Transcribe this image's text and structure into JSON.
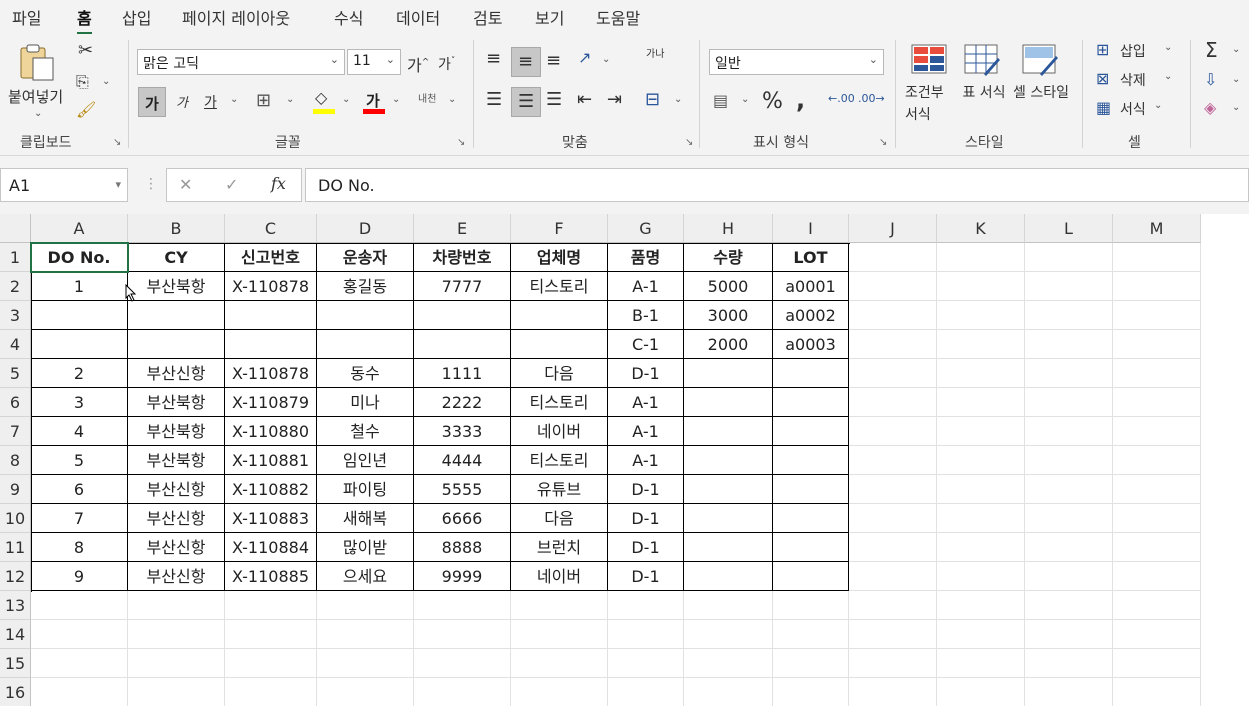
{
  "menu": {
    "tabs": [
      "파일",
      "홈",
      "삽입",
      "페이지 레이아웃",
      "수식",
      "데이터",
      "검토",
      "보기",
      "도움말"
    ],
    "active": "홈"
  },
  "ribbon": {
    "clipboard": {
      "paste": "붙여넣기",
      "label": "클립보드"
    },
    "font": {
      "name": "맑은 고딕",
      "size": "11",
      "bold": "가",
      "italic": "가",
      "underline": "가",
      "font_color": "가",
      "grow": "가",
      "shrink": "가",
      "phonetic": "내천",
      "label": "글꼴"
    },
    "alignment": {
      "wrap": "가나",
      "label": "맞춤"
    },
    "number": {
      "format": "일반",
      "percent": "%",
      "comma": ",",
      "inc_decimal": ".00",
      "dec_decimal": ".00",
      "label": "표시 형식"
    },
    "styles": {
      "conditional": "조건부 서식",
      "table": "표 서식",
      "cell": "셀 스타일",
      "label": "스타일"
    },
    "cells": {
      "insert": "삽입",
      "delete": "삭제",
      "format": "서식",
      "label": "셀"
    },
    "editing": {
      "autosum": "Σ"
    },
    "accent_color": "#217346",
    "font_color_bar": "#ff0000",
    "fill_color_bar": "#ffff00"
  },
  "formula_bar": {
    "name_box": "A1",
    "cancel": "✕",
    "enter": "✓",
    "fx": "fx",
    "content": "DO No."
  },
  "sheet": {
    "columns": [
      "A",
      "B",
      "C",
      "D",
      "E",
      "F",
      "G",
      "H",
      "I",
      "J",
      "K",
      "L",
      "M"
    ],
    "rows": [
      "1",
      "2",
      "3",
      "4",
      "5",
      "6",
      "7",
      "8",
      "9",
      "10",
      "11",
      "12",
      "13",
      "14",
      "15",
      "16"
    ],
    "header": [
      "DO No.",
      "CY",
      "신고번호",
      "운송자",
      "차량번호",
      "업체명",
      "품명",
      "수량",
      "LOT"
    ],
    "data": [
      [
        "1",
        "부산북항",
        "X-110878",
        "홍길동",
        "7777",
        "티스토리",
        "A-1",
        "5000",
        "a0001"
      ],
      [
        "",
        "",
        "",
        "",
        "",
        "",
        "B-1",
        "3000",
        "a0002"
      ],
      [
        "",
        "",
        "",
        "",
        "",
        "",
        "C-1",
        "2000",
        "a0003"
      ],
      [
        "2",
        "부산신항",
        "X-110878",
        "동수",
        "1111",
        "다음",
        "D-1",
        "",
        ""
      ],
      [
        "3",
        "부산북항",
        "X-110879",
        "미나",
        "2222",
        "티스토리",
        "A-1",
        "",
        ""
      ],
      [
        "4",
        "부산북항",
        "X-110880",
        "철수",
        "3333",
        "네이버",
        "A-1",
        "",
        ""
      ],
      [
        "5",
        "부산북항",
        "X-110881",
        "임인년",
        "4444",
        "티스토리",
        "A-1",
        "",
        ""
      ],
      [
        "6",
        "부산신항",
        "X-110882",
        "파이팅",
        "5555",
        "유튜브",
        "D-1",
        "",
        ""
      ],
      [
        "7",
        "부산신항",
        "X-110883",
        "새해복",
        "6666",
        "다음",
        "D-1",
        "",
        ""
      ],
      [
        "8",
        "부산신항",
        "X-110884",
        "많이받",
        "8888",
        "브런치",
        "D-1",
        "",
        ""
      ],
      [
        "9",
        "부산신항",
        "X-110885",
        "으세요",
        "9999",
        "네이버",
        "D-1",
        "",
        ""
      ]
    ]
  }
}
